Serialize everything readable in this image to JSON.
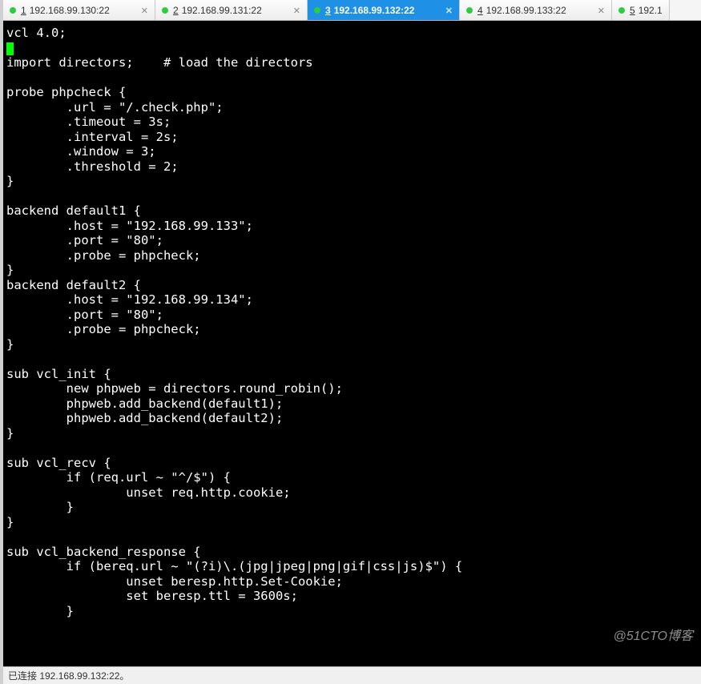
{
  "tabs": [
    {
      "index": "1",
      "label": "192.168.99.130:22",
      "active": false,
      "status": "green"
    },
    {
      "index": "2",
      "label": "192.168.99.131:22",
      "active": false,
      "status": "green"
    },
    {
      "index": "3",
      "label": "192.168.99.132:22",
      "active": true,
      "status": "green"
    },
    {
      "index": "4",
      "label": "192.168.99.133:22",
      "active": false,
      "status": "green"
    },
    {
      "index": "5",
      "label": "192.1",
      "active": false,
      "status": "green"
    }
  ],
  "terminal": {
    "content": "vcl 4.0;\n\nimport directors;    # load the directors\n\nprobe phpcheck {\n        .url = \"/.check.php\";\n        .timeout = 3s;\n        .interval = 2s;\n        .window = 3;\n        .threshold = 2;\n}\n\nbackend default1 {\n        .host = \"192.168.99.133\";\n        .port = \"80\";\n        .probe = phpcheck;\n}\nbackend default2 {\n        .host = \"192.168.99.134\";\n        .port = \"80\";\n        .probe = phpcheck;\n}\n\nsub vcl_init {\n        new phpweb = directors.round_robin();\n        phpweb.add_backend(default1);\n        phpweb.add_backend(default2);\n}\n\nsub vcl_recv {\n        if (req.url ~ \"^/$\") {\n                unset req.http.cookie;\n        }\n}\n\nsub vcl_backend_response {\n        if (bereq.url ~ \"(?i)\\.(jpg|jpeg|png|gif|css|js)$\") {\n                unset beresp.http.Set-Cookie;\n                set beresp.ttl = 3600s;\n        }"
  },
  "statusbar": {
    "text": "已连接 192.168.99.132:22。"
  },
  "watermark": "@51CTO博客"
}
